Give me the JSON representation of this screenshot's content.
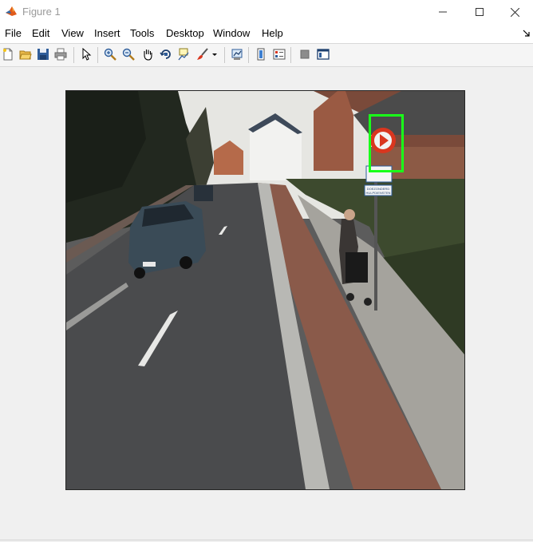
{
  "window": {
    "title": "Figure 1"
  },
  "menu": {
    "items": [
      "File",
      "Edit",
      "View",
      "Insert",
      "Tools",
      "Desktop",
      "Window",
      "Help"
    ]
  },
  "toolbar": {
    "icons": [
      "new-figure-icon",
      "open-file-icon",
      "save-icon",
      "print-icon",
      "select-pointer-icon",
      "zoom-in-icon",
      "zoom-out-icon",
      "pan-hand-icon",
      "rotate-3d-icon",
      "data-cursor-icon",
      "brush-icon",
      "link-plot-icon",
      "colorbar-icon",
      "legend-icon",
      "hide-plot-tools-icon",
      "show-plot-tools-icon"
    ]
  },
  "image": {
    "content": "street-scene-with-detected-traffic-sign",
    "sign_text_1": "DOEZONDERD",
    "sign_text_2": "HULPDIENSTEN",
    "car_plate": "DR-AS",
    "colors": {
      "detection_box": "#19ff19",
      "sign_red": "#d9361f"
    }
  }
}
